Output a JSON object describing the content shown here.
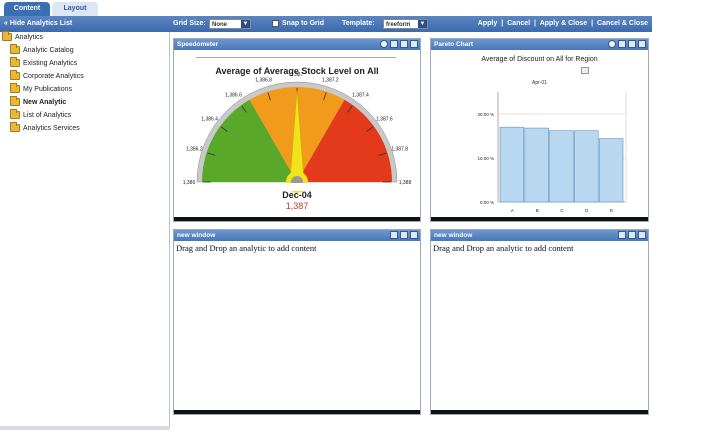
{
  "tabs": [
    {
      "label": "Content"
    },
    {
      "label": "Layout"
    }
  ],
  "toolbar": {
    "hide_link": "« Hide Analytics List",
    "grid_size_label": "Grid Size:",
    "grid_size_value": "None",
    "snap_label": "Snap to Grid",
    "template_label": "Template:",
    "template_value": "freeform",
    "apply": "Apply",
    "cancel": "Cancel",
    "apply_close": "Apply & Close",
    "cancel_close": "Cancel & Close",
    "sep": "|"
  },
  "tree": {
    "root": "Analytics",
    "items": [
      {
        "label": "Analytic Catalog",
        "bold": false
      },
      {
        "label": "Existing Analytics",
        "bold": false
      },
      {
        "label": "Corporate Analytics",
        "bold": false
      },
      {
        "label": "My Publications",
        "bold": false
      },
      {
        "label": "New Analytic",
        "bold": true
      },
      {
        "label": "List of Analytics",
        "bold": false
      },
      {
        "label": "Analytics Services",
        "bold": false
      }
    ]
  },
  "panels": {
    "speedometer": {
      "title": "Speedometer",
      "chart_title": "Average of Average Stock Level on All",
      "date": "Dec-04",
      "value": "1,387",
      "ticks": [
        "1,386",
        "1,386.2",
        "1,386.4",
        "1,386.6",
        "1,386.8",
        "1,387",
        "1,387.2",
        "1,387.4",
        "1,387.6",
        "1,387.8",
        "1,388"
      ],
      "colors": {
        "green": "#5aa82a",
        "orange": "#f29a1c",
        "red": "#e23a1a",
        "needle": "#f2e21a"
      }
    },
    "pareto": {
      "title": "Pareto Chart",
      "chart_title": "Average of Discount on All for Region",
      "period": "Apr-01"
    },
    "window1": {
      "title": "new window",
      "message": "Drag and Drop an analytic to add content"
    },
    "window2": {
      "title": "new window",
      "message": "Drag and Drop an analytic to add content"
    }
  },
  "chart_data": [
    {
      "type": "gauge",
      "title": "Average of Average Stock Level on All",
      "min": 1386,
      "max": 1388,
      "value": 1387,
      "ticks": [
        "1,386",
        "1,386.2",
        "1,386.4",
        "1,386.6",
        "1,386.8",
        "1,387",
        "1,387.2",
        "1,387.4",
        "1,387.6",
        "1,387.8",
        "1,388"
      ]
    },
    {
      "type": "bar",
      "title": "Average of Discount on All for Region",
      "categories": [
        "A",
        "B",
        "C",
        "D",
        "E"
      ],
      "values": [
        17.0,
        16.8,
        16.2,
        16.2,
        14.4
      ],
      "ylim": [
        0,
        25
      ],
      "ytick_labels": [
        "0.00 %",
        "10.00 %",
        "20.00 %"
      ],
      "ytick_values": [
        0,
        10,
        20
      ]
    }
  ]
}
